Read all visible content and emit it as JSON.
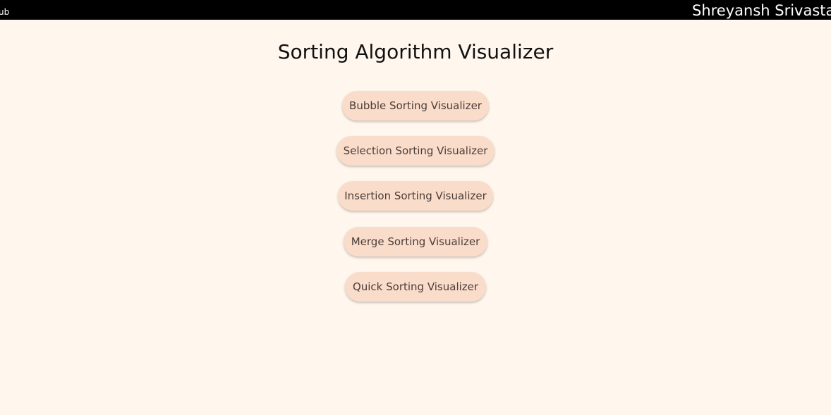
{
  "header": {
    "left_link": "ub",
    "author": "Shreyansh Srivasta"
  },
  "page": {
    "title": "Sorting Algorithm Visualizer"
  },
  "menu": {
    "items": [
      {
        "label": "Bubble Sorting Visualizer"
      },
      {
        "label": "Selection Sorting Visualizer"
      },
      {
        "label": "Insertion Sorting Visualizer"
      },
      {
        "label": "Merge Sorting Visualizer"
      },
      {
        "label": "Quick Sorting Visualizer"
      }
    ]
  },
  "colors": {
    "background": "#fff6ed",
    "topbar": "#000000",
    "button": "#fadcca",
    "button_text": "#4a3d38"
  }
}
